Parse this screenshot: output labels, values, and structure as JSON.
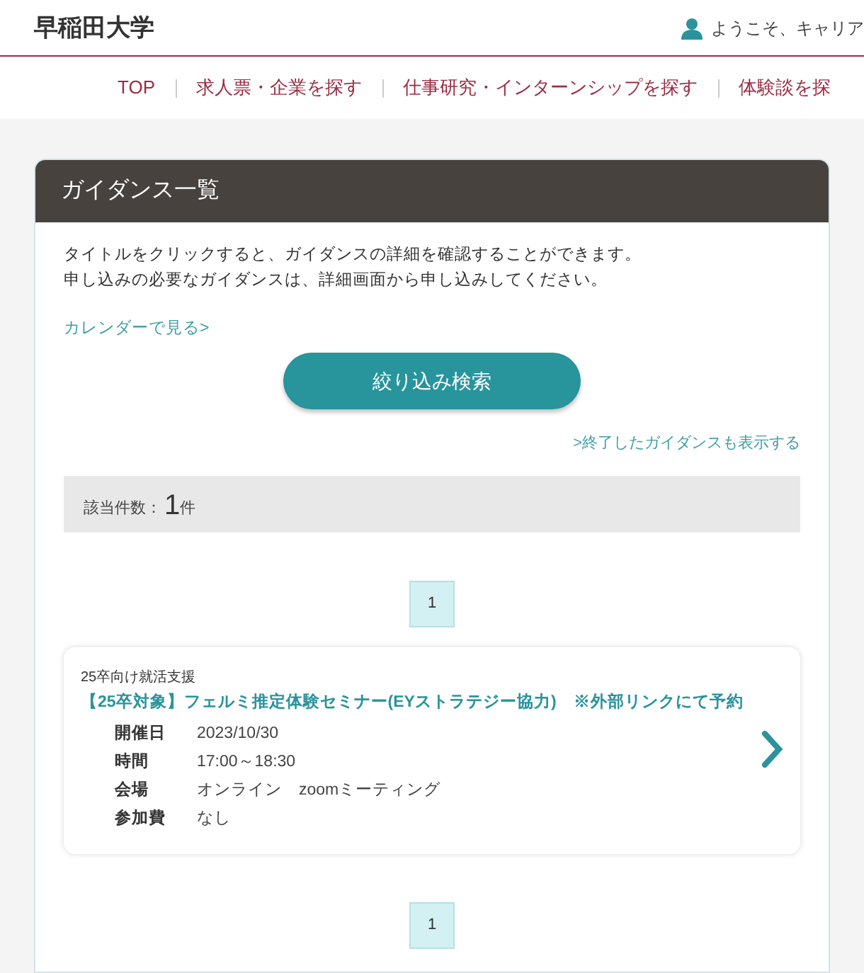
{
  "header": {
    "logo": "早稲田大学",
    "welcome": "ようこそ、キャリア"
  },
  "nav": [
    {
      "label": "TOP"
    },
    {
      "label": "求人票・企業を探す"
    },
    {
      "label": "仕事研究・インターンシップを探す"
    },
    {
      "label": "体験談を探"
    }
  ],
  "panel": {
    "title": "ガイダンス一覧",
    "intro": [
      "タイトルをクリックすると、ガイダンスの詳細を確認することができます。",
      "申し込みの必要なガイダンスは、詳細画面から申し込みしてください。"
    ],
    "calendar_link": "カレンダーで見る>",
    "search_button": "絞り込み検索",
    "show_ended_link": ">終了したガイダンスも表示する",
    "count_label": "該当件数：",
    "count": "1",
    "count_unit": "件",
    "pagination_top": [
      {
        "label": "1",
        "selected": true
      }
    ],
    "events": [
      {
        "category": "25卒向け就活支援",
        "title": "【25卒対象】フェルミ推定体験セミナー(EYストラテジー協力)　※外部リンクにて予約",
        "details": [
          {
            "label": "開催日",
            "value": "2023/10/30"
          },
          {
            "label": "時間",
            "value": "17:00～18:30"
          },
          {
            "label": "会場",
            "value": "オンライン　zoomミーティング"
          },
          {
            "label": "参加費",
            "value": "なし"
          }
        ]
      }
    ],
    "pagination_bottom": [
      {
        "label": "1",
        "selected": true
      }
    ]
  }
}
